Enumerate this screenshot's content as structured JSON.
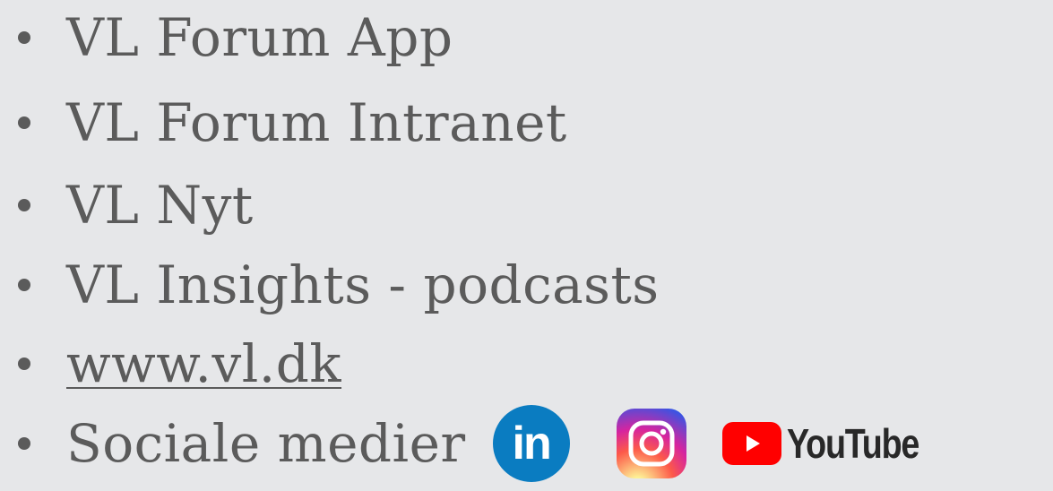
{
  "items": [
    {
      "label": "VL Forum App"
    },
    {
      "label": "VL Forum Intranet"
    },
    {
      "label": "VL Nyt"
    },
    {
      "label": "VL Insights - podcasts"
    },
    {
      "label": "www.vl.dk"
    },
    {
      "label": "Sociale medier"
    }
  ],
  "social": {
    "linkedin_text": "in",
    "youtube_text": "YouTube",
    "icons": [
      "linkedin-icon",
      "instagram-icon",
      "youtube-icon"
    ]
  },
  "colors": {
    "background": "#e6e7e9",
    "text": "#5b5b5b",
    "linkedin": "#0a7cc1",
    "youtube_red": "#ff0000"
  }
}
